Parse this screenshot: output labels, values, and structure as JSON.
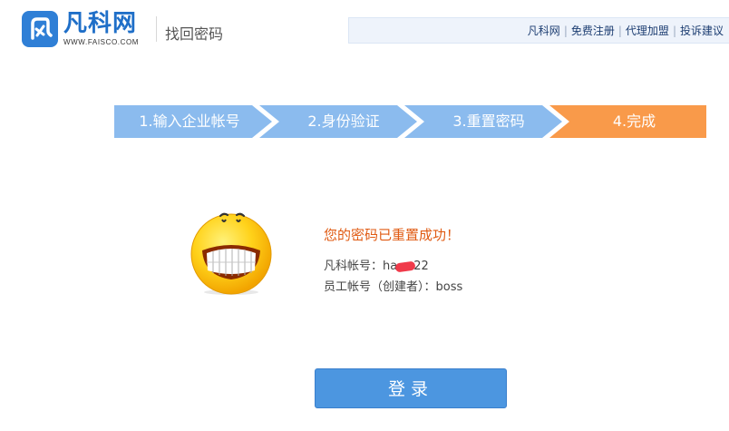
{
  "header": {
    "logo_name": "凡科网",
    "logo_domain": "WWW.FAISCO.COM",
    "page_title": "找回密码"
  },
  "top_nav": {
    "links": [
      "凡科网",
      "免费注册",
      "代理加盟",
      "投诉建议"
    ],
    "separator": "|"
  },
  "steps": [
    {
      "label": "1.输入企业帐号",
      "state": "done"
    },
    {
      "label": "2.身份验证",
      "state": "done"
    },
    {
      "label": "3.重置密码",
      "state": "done"
    },
    {
      "label": "4.完成",
      "state": "current"
    }
  ],
  "result": {
    "message": "您的密码已重置成功！",
    "account_label": "凡科帐号：",
    "account_value_prefix": "ha",
    "account_value_suffix": "22",
    "employee_label": "员工帐号（创建者）：",
    "employee_value": "boss"
  },
  "login_button": "登录",
  "colors": {
    "brand_blue": "#1f6fc8",
    "step_done": "#8bbbee",
    "step_current": "#f99a4a",
    "success_text": "#e05a12",
    "button": "#4c96e0"
  }
}
